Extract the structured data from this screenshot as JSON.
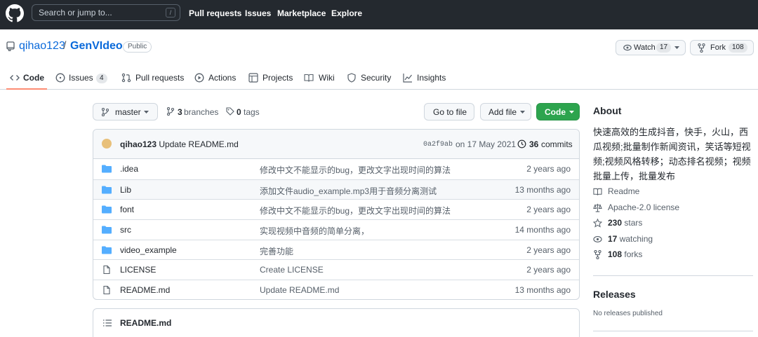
{
  "header": {
    "search_placeholder": "Search or jump to...",
    "search_shortcut": "/",
    "nav": [
      "Pull requests",
      "Issues",
      "Marketplace",
      "Explore"
    ]
  },
  "repo": {
    "owner": "qihao123",
    "separator": "/",
    "name": "GenVIdeo",
    "visibility": "Public",
    "watch_label": "Watch",
    "watch_count": "17",
    "fork_label": "Fork",
    "fork_count": "108"
  },
  "tabs": {
    "code": "Code",
    "issues": "Issues",
    "issues_count": "4",
    "pull_requests": "Pull requests",
    "actions": "Actions",
    "projects": "Projects",
    "wiki": "Wiki",
    "security": "Security",
    "insights": "Insights"
  },
  "branchbar": {
    "branch": "master",
    "branches_count": "3",
    "branches_label": "branches",
    "tags_count": "0",
    "tags_label": "tags",
    "go_to_file": "Go to file",
    "add_file": "Add file",
    "code": "Code"
  },
  "latest_commit": {
    "author": "qihao123",
    "message": "Update README.md",
    "sha": "0a2f9ab",
    "date": "on 17 May 2021",
    "commits_count": "36",
    "commits_label": "commits"
  },
  "files": [
    {
      "name": ".idea",
      "type": "dir",
      "message": "修改中文不能显示的bug，更改文字出现时间的算法",
      "age": "2 years ago"
    },
    {
      "name": "Lib",
      "type": "dir",
      "message": "添加文件audio_example.mp3用于音频分离测试",
      "age": "13 months ago"
    },
    {
      "name": "font",
      "type": "dir",
      "message": "修改中文不能显示的bug，更改文字出现时间的算法",
      "age": "2 years ago"
    },
    {
      "name": "src",
      "type": "dir",
      "message": "实现视频中音频的简单分离，",
      "age": "14 months ago"
    },
    {
      "name": "video_example",
      "type": "dir",
      "message": "完善功能",
      "age": "2 years ago"
    },
    {
      "name": "LICENSE",
      "type": "file",
      "message": "Create LICENSE",
      "age": "2 years ago"
    },
    {
      "name": "README.md",
      "type": "file",
      "message": "Update README.md",
      "age": "13 months ago"
    }
  ],
  "readme": {
    "title": "README.md"
  },
  "about": {
    "heading": "About",
    "description": "快速高效的生成抖音，快手，火山，西瓜视频;批量制作新闻资讯，笑话等短视频;视频风格转移；动态排名视频；视频批量上传，批量发布",
    "readme": "Readme",
    "license": "Apache-2.0 license",
    "stars_count": "230",
    "stars_label": "stars",
    "watching_count": "17",
    "watching_label": "watching",
    "forks_count": "108",
    "forks_label": "forks"
  },
  "releases": {
    "heading": "Releases",
    "note": "No releases published"
  },
  "colors": {
    "header_bg": "#24292f",
    "link": "#0969da",
    "primary_green": "#2da44e",
    "folder_blue": "#54aeff",
    "tab_underline": "#fd8c73"
  }
}
